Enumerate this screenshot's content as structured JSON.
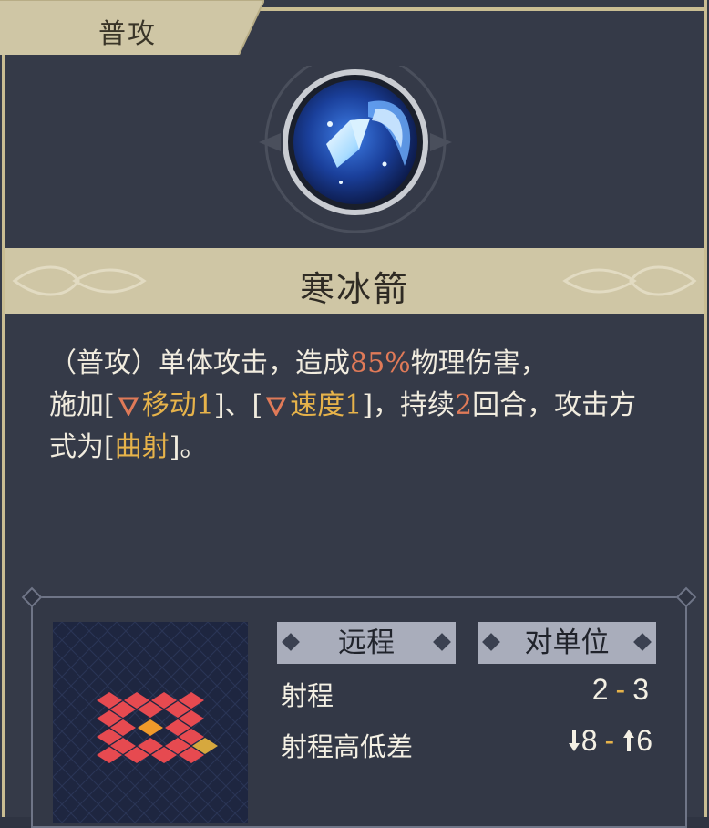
{
  "tab": {
    "label": "普攻"
  },
  "skill": {
    "name": "寒冰箭",
    "icon": "ice-arrow-icon"
  },
  "description": {
    "p1": "（普攻）单体攻击，造成",
    "damage_pct": "85%",
    "p2": "物理伤害，",
    "p3": "施加[",
    "debuff1": "移动1",
    "p4": "]、[",
    "debuff2": "速度1",
    "p5": "]，持续",
    "turns": "2",
    "p6": "回合，攻击方式为[",
    "attack_mode": "曲射",
    "p7": "]。"
  },
  "info": {
    "type_tag": "远程",
    "target_tag": "对单位",
    "range_label": "射程",
    "range_min": "2",
    "range_sep": "-",
    "range_max": "3",
    "height_label": "射程高低差",
    "height_down": "8",
    "height_up": "6",
    "height_sep": "-"
  },
  "colors": {
    "highlight_red": "#e07a58",
    "highlight_gold": "#e7b34a",
    "range_cell": "#e64a50",
    "target_cell": "#d6a83e",
    "origin_cell": "#ef9a2a"
  }
}
